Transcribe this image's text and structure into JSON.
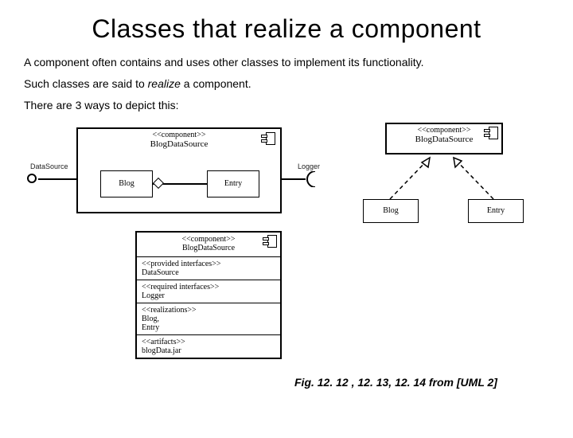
{
  "title": "Classes that realize a component",
  "description_line1": "A component often contains and uses other classes to implement its functionality.",
  "description_line2_pre": "Such classes are said to ",
  "description_line2_em": "realize",
  "description_line2_post": " a component.",
  "description_line3": "There are 3 ways to depict this:",
  "diagram1": {
    "stereotype": "<<component>>",
    "component_name": "BlogDataSource",
    "iface_provided": "DataSource",
    "iface_required": "Logger",
    "class_a": "Blog",
    "class_b": "Entry"
  },
  "diagram2": {
    "stereotype": "<<component>>",
    "component_name": "BlogDataSource",
    "class_a": "Blog",
    "class_b": "Entry"
  },
  "diagram3": {
    "stereotype": "<<component>>",
    "component_name": "BlogDataSource",
    "sec_provided_h": "<<provided interfaces>>",
    "sec_provided_v": "DataSource",
    "sec_required_h": "<<required interfaces>>",
    "sec_required_v": "Logger",
    "sec_realize_h": "<<realizations>>",
    "sec_realize_v1": "Blog,",
    "sec_realize_v2": "Entry",
    "sec_artifact_h": "<<artifacts>>",
    "sec_artifact_v": "blogData.jar"
  },
  "caption": "Fig. 12. 12 , 12. 13, 12. 14   from [UML 2]"
}
